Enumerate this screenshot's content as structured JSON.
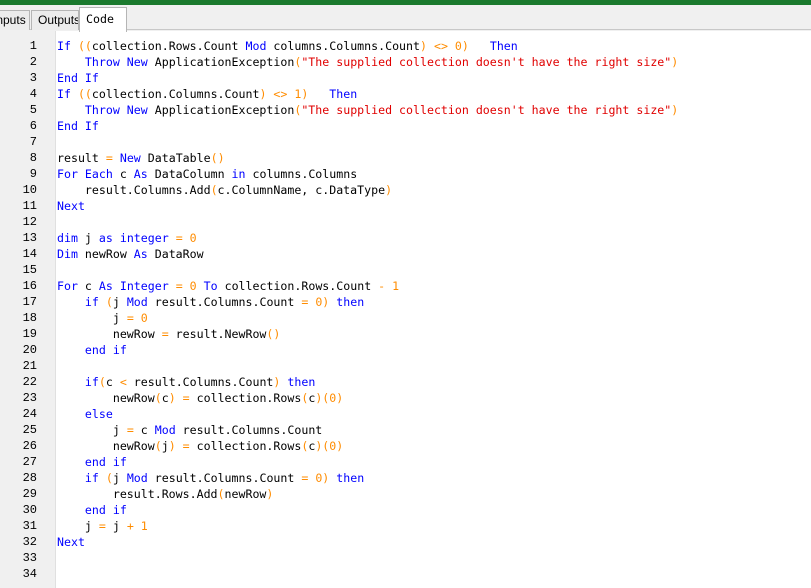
{
  "tabs": [
    {
      "label": "Inputs"
    },
    {
      "label": "Outputs"
    },
    {
      "label": "Code",
      "active": true
    }
  ],
  "colors": {
    "keyword": "#0000ff",
    "string": "#e00000",
    "number_operator": "#ff8c00",
    "identifier": "#000000",
    "top_bar": "#1b7a2e"
  },
  "code_lines": [
    {
      "n": "1",
      "tokens": [
        [
          "kw",
          "If"
        ],
        [
          "id",
          " "
        ],
        [
          "op",
          "(("
        ],
        [
          "id",
          "collection.Rows.Count "
        ],
        [
          "kw",
          "Mod"
        ],
        [
          "id",
          " columns.Columns.Count"
        ],
        [
          "op",
          ")"
        ],
        [
          "id",
          " "
        ],
        [
          "op",
          "<>"
        ],
        [
          "id",
          " "
        ],
        [
          "num",
          "0"
        ],
        [
          "op",
          ")"
        ],
        [
          "id",
          "   "
        ],
        [
          "kw",
          "Then"
        ]
      ]
    },
    {
      "n": "2",
      "tokens": [
        [
          "id",
          "    "
        ],
        [
          "kw",
          "Throw New"
        ],
        [
          "id",
          " ApplicationException"
        ],
        [
          "op",
          "("
        ],
        [
          "str",
          "\"The supplied collection doesn't have the right size\""
        ],
        [
          "op",
          ")"
        ]
      ]
    },
    {
      "n": "3",
      "tokens": [
        [
          "kw",
          "End If"
        ]
      ]
    },
    {
      "n": "4",
      "tokens": [
        [
          "kw",
          "If"
        ],
        [
          "id",
          " "
        ],
        [
          "op",
          "(("
        ],
        [
          "id",
          "collection.Columns.Count"
        ],
        [
          "op",
          ")"
        ],
        [
          "id",
          " "
        ],
        [
          "op",
          "<>"
        ],
        [
          "id",
          " "
        ],
        [
          "num",
          "1"
        ],
        [
          "op",
          ")"
        ],
        [
          "id",
          "   "
        ],
        [
          "kw",
          "Then"
        ]
      ]
    },
    {
      "n": "5",
      "tokens": [
        [
          "id",
          "    "
        ],
        [
          "kw",
          "Throw New"
        ],
        [
          "id",
          " ApplicationException"
        ],
        [
          "op",
          "("
        ],
        [
          "str",
          "\"The supplied collection doesn't have the right size\""
        ],
        [
          "op",
          ")"
        ]
      ]
    },
    {
      "n": "6",
      "tokens": [
        [
          "kw",
          "End If"
        ]
      ]
    },
    {
      "n": "7",
      "tokens": []
    },
    {
      "n": "8",
      "tokens": [
        [
          "id",
          "result "
        ],
        [
          "op",
          "="
        ],
        [
          "id",
          " "
        ],
        [
          "kw",
          "New"
        ],
        [
          "id",
          " DataTable"
        ],
        [
          "op",
          "()"
        ]
      ]
    },
    {
      "n": "9",
      "tokens": [
        [
          "kw",
          "For Each"
        ],
        [
          "id",
          " c "
        ],
        [
          "kw",
          "As"
        ],
        [
          "id",
          " DataColumn "
        ],
        [
          "kw",
          "in"
        ],
        [
          "id",
          " columns.Columns"
        ]
      ]
    },
    {
      "n": "10",
      "tokens": [
        [
          "id",
          "    result.Columns.Add"
        ],
        [
          "op",
          "("
        ],
        [
          "id",
          "c.ColumnName, c.DataType"
        ],
        [
          "op",
          ")"
        ]
      ]
    },
    {
      "n": "11",
      "tokens": [
        [
          "kw",
          "Next"
        ]
      ]
    },
    {
      "n": "12",
      "tokens": []
    },
    {
      "n": "13",
      "tokens": [
        [
          "kw",
          "dim"
        ],
        [
          "id",
          " j "
        ],
        [
          "kw",
          "as integer"
        ],
        [
          "id",
          " "
        ],
        [
          "op",
          "="
        ],
        [
          "id",
          " "
        ],
        [
          "num",
          "0"
        ]
      ]
    },
    {
      "n": "14",
      "tokens": [
        [
          "kw",
          "Dim"
        ],
        [
          "id",
          " newRow "
        ],
        [
          "kw",
          "As"
        ],
        [
          "id",
          " DataRow"
        ]
      ]
    },
    {
      "n": "15",
      "tokens": []
    },
    {
      "n": "16",
      "tokens": [
        [
          "kw",
          "For"
        ],
        [
          "id",
          " c "
        ],
        [
          "kw",
          "As Integer"
        ],
        [
          "id",
          " "
        ],
        [
          "op",
          "="
        ],
        [
          "id",
          " "
        ],
        [
          "num",
          "0"
        ],
        [
          "id",
          " "
        ],
        [
          "kw",
          "To"
        ],
        [
          "id",
          " collection.Rows.Count "
        ],
        [
          "op",
          "-"
        ],
        [
          "id",
          " "
        ],
        [
          "num",
          "1"
        ]
      ]
    },
    {
      "n": "17",
      "tokens": [
        [
          "id",
          "    "
        ],
        [
          "kw",
          "if"
        ],
        [
          "id",
          " "
        ],
        [
          "op",
          "("
        ],
        [
          "id",
          "j "
        ],
        [
          "kw",
          "Mod"
        ],
        [
          "id",
          " result.Columns.Count "
        ],
        [
          "op",
          "="
        ],
        [
          "id",
          " "
        ],
        [
          "num",
          "0"
        ],
        [
          "op",
          ")"
        ],
        [
          "id",
          " "
        ],
        [
          "kw",
          "then"
        ]
      ]
    },
    {
      "n": "18",
      "tokens": [
        [
          "id",
          "        j "
        ],
        [
          "op",
          "="
        ],
        [
          "id",
          " "
        ],
        [
          "num",
          "0"
        ]
      ]
    },
    {
      "n": "19",
      "tokens": [
        [
          "id",
          "        newRow "
        ],
        [
          "op",
          "="
        ],
        [
          "id",
          " result.NewRow"
        ],
        [
          "op",
          "()"
        ]
      ]
    },
    {
      "n": "20",
      "tokens": [
        [
          "id",
          "    "
        ],
        [
          "kw",
          "end if"
        ]
      ]
    },
    {
      "n": "21",
      "tokens": []
    },
    {
      "n": "22",
      "tokens": [
        [
          "id",
          "    "
        ],
        [
          "kw",
          "if"
        ],
        [
          "op",
          "("
        ],
        [
          "id",
          "c "
        ],
        [
          "op",
          "<"
        ],
        [
          "id",
          " result.Columns.Count"
        ],
        [
          "op",
          ")"
        ],
        [
          "id",
          " "
        ],
        [
          "kw",
          "then"
        ]
      ]
    },
    {
      "n": "23",
      "tokens": [
        [
          "id",
          "        newRow"
        ],
        [
          "op",
          "("
        ],
        [
          "id",
          "c"
        ],
        [
          "op",
          ")"
        ],
        [
          "id",
          " "
        ],
        [
          "op",
          "="
        ],
        [
          "id",
          " collection.Rows"
        ],
        [
          "op",
          "("
        ],
        [
          "id",
          "c"
        ],
        [
          "op",
          ")("
        ],
        [
          "num",
          "0"
        ],
        [
          "op",
          ")"
        ]
      ]
    },
    {
      "n": "24",
      "tokens": [
        [
          "id",
          "    "
        ],
        [
          "kw",
          "else"
        ]
      ]
    },
    {
      "n": "25",
      "tokens": [
        [
          "id",
          "        j "
        ],
        [
          "op",
          "="
        ],
        [
          "id",
          " c "
        ],
        [
          "kw",
          "Mod"
        ],
        [
          "id",
          " result.Columns.Count"
        ]
      ]
    },
    {
      "n": "26",
      "tokens": [
        [
          "id",
          "        newRow"
        ],
        [
          "op",
          "("
        ],
        [
          "id",
          "j"
        ],
        [
          "op",
          ")"
        ],
        [
          "id",
          " "
        ],
        [
          "op",
          "="
        ],
        [
          "id",
          " collection.Rows"
        ],
        [
          "op",
          "("
        ],
        [
          "id",
          "c"
        ],
        [
          "op",
          ")("
        ],
        [
          "num",
          "0"
        ],
        [
          "op",
          ")"
        ]
      ]
    },
    {
      "n": "27",
      "tokens": [
        [
          "id",
          "    "
        ],
        [
          "kw",
          "end if"
        ]
      ]
    },
    {
      "n": "28",
      "tokens": [
        [
          "id",
          "    "
        ],
        [
          "kw",
          "if"
        ],
        [
          "id",
          " "
        ],
        [
          "op",
          "("
        ],
        [
          "id",
          "j "
        ],
        [
          "kw",
          "Mod"
        ],
        [
          "id",
          " result.Columns.Count "
        ],
        [
          "op",
          "="
        ],
        [
          "id",
          " "
        ],
        [
          "num",
          "0"
        ],
        [
          "op",
          ")"
        ],
        [
          "id",
          " "
        ],
        [
          "kw",
          "then"
        ]
      ]
    },
    {
      "n": "29",
      "tokens": [
        [
          "id",
          "        result.Rows.Add"
        ],
        [
          "op",
          "("
        ],
        [
          "id",
          "newRow"
        ],
        [
          "op",
          ")"
        ]
      ]
    },
    {
      "n": "30",
      "tokens": [
        [
          "id",
          "    "
        ],
        [
          "kw",
          "end if"
        ]
      ]
    },
    {
      "n": "31",
      "tokens": [
        [
          "id",
          "    j "
        ],
        [
          "op",
          "="
        ],
        [
          "id",
          " j "
        ],
        [
          "op",
          "+"
        ],
        [
          "id",
          " "
        ],
        [
          "num",
          "1"
        ]
      ]
    },
    {
      "n": "32",
      "tokens": [
        [
          "kw",
          "Next"
        ]
      ]
    },
    {
      "n": "33",
      "tokens": []
    },
    {
      "n": "34",
      "tokens": []
    }
  ]
}
